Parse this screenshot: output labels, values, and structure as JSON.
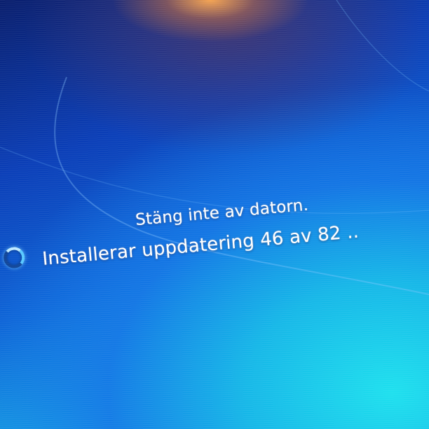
{
  "screen": {
    "title": "Stäng inte av datorn.",
    "status": "Installerar uppdatering 46 av 82  ..",
    "spinner_icon": "loading-spinner-icon"
  },
  "colors": {
    "background_dark": "#0a1f6e",
    "background_mid": "#0e63d6",
    "background_light": "#1fd6ee",
    "text": "#ffffff"
  }
}
